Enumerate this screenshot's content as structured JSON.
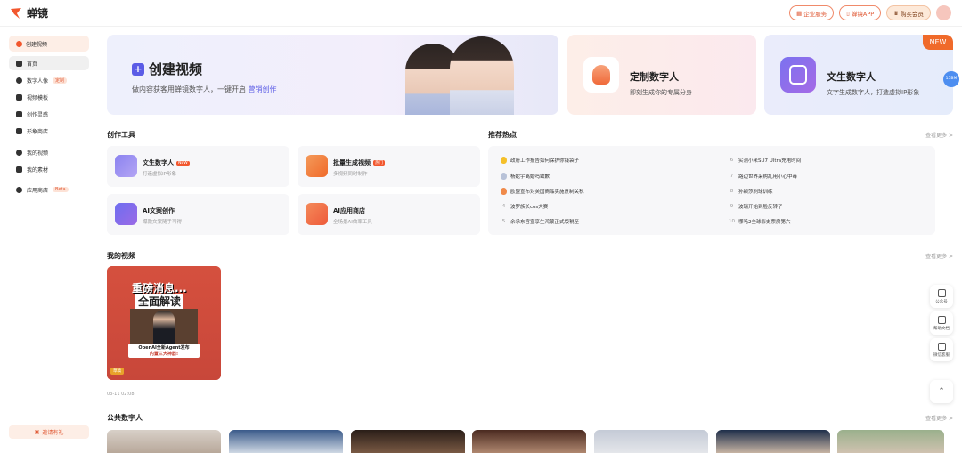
{
  "brand": {
    "name": "蝉镜",
    "accent": "#f2572e",
    "purple": "#5b5ce6"
  },
  "topbar": {
    "enterprise": "企业服务",
    "app": "蝉镜APP",
    "vip": "购买会员"
  },
  "sidebar": {
    "create": "创建视频",
    "items": [
      {
        "label": "首页",
        "icon": "home-icon"
      },
      {
        "label": "数字人像",
        "icon": "user-icon",
        "badge": "定制"
      },
      {
        "label": "视频模板",
        "icon": "grid-icon"
      },
      {
        "label": "创作灵感",
        "icon": "bulb-icon"
      },
      {
        "label": "形象商店",
        "icon": "shop-icon"
      },
      {
        "label": "我的视频",
        "icon": "play-icon"
      },
      {
        "label": "我的素材",
        "icon": "folder-icon"
      },
      {
        "label": "应用商店",
        "icon": "apps-icon",
        "badge": "Beta"
      }
    ],
    "invite": "邀请有礼"
  },
  "banner": {
    "title": "创建视频",
    "sub_prefix": "做内容获客用蝉镜数字人，一键开启",
    "sub_link": "营销创作"
  },
  "card_custom": {
    "title": "定制数字人",
    "sub": "即刻生成你的专属分身"
  },
  "card_text": {
    "title": "文生数字人",
    "sub": "文字生成数字人，打造虚拟IP形象",
    "new": "NEW",
    "side_badge": "15BM"
  },
  "tools": {
    "title": "创作工具",
    "items": [
      {
        "title": "文生数字人",
        "tag": "NEW",
        "sub": "打造虚拟IP形象"
      },
      {
        "title": "批量生成视频",
        "tag": "热门",
        "sub": "多视频同时制作"
      },
      {
        "title": "AI文案创作",
        "sub": "爆款文案随手可得"
      },
      {
        "title": "AI应用商店",
        "sub": "全场景AI效率工具"
      }
    ]
  },
  "hot": {
    "title": "推荐热点",
    "more": "查看更多 >",
    "left": [
      {
        "rank": "1",
        "text": "政府工作报告如何保护你钱袋子"
      },
      {
        "rank": "2",
        "text": "杨妮宇离婚吗致歉"
      },
      {
        "rank": "3",
        "text": "欧盟宣布对美国商品实施反制关税"
      },
      {
        "rank": "4",
        "text": "波罗族长cos大赛"
      },
      {
        "rank": "5",
        "text": "余承东官宣享生鸿蒙正式版税至"
      }
    ],
    "right": [
      {
        "rank": "6",
        "text": "实测小米SU7 Ultra充电时间"
      },
      {
        "rank": "7",
        "text": "路边世界采购乱用小心中毒"
      },
      {
        "rank": "8",
        "text": "孙颖莎刷球训练"
      },
      {
        "rank": "9",
        "text": "波瑞开始到脸反转了"
      },
      {
        "rank": "10",
        "text": "哪吒2全球影史票房第六"
      }
    ]
  },
  "my_videos": {
    "title": "我的视频",
    "more": "查看更多 >",
    "video": {
      "headline1": "重磅消息...",
      "headline2": "全面解读",
      "caption1": "OpenAI全新Agent发布",
      "caption2": "内置三大神器!",
      "status": "草稿",
      "date": "03-11 02:08"
    }
  },
  "public": {
    "title": "公共数字人",
    "more": "查看更多 >"
  },
  "float": {
    "official": "公众号",
    "docs": "帮助文档",
    "wechat": "微信客服"
  }
}
